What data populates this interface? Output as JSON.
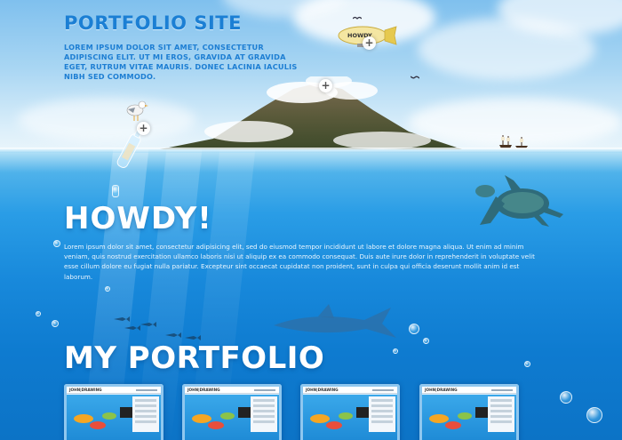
{
  "header": {
    "title": "PORTFOLIO SITE",
    "intro": "LOREM IPSUM DOLOR SIT AMET, CONSECTETUR ADIPISCING ELIT. UT MI EROS, GRAVIDA AT GRAVIDA EGET, RUTRUM VITAE MAURIS. DONEC LACINIA IACULIS NIBH SED COMMODO."
  },
  "blimp": {
    "label": "HOWDY"
  },
  "about": {
    "heading": "HOWDY!",
    "text": "Lorem ipsum dolor sit amet, consectetur adipisicing elit, sed do eiusmod tempor incididunt ut labore et dolore magna aliqua. Ut enim ad minim veniam, quis nostrud exercitation ullamco laboris nisi ut aliquip ex ea commodo consequat. Duis aute irure dolor in reprehenderit in voluptate velit esse cillum dolore eu fugiat nulla pariatur. Excepteur sint occaecat cupidatat non proident, sunt in culpa qui officia deserunt mollit anim id est laborum."
  },
  "portfolio": {
    "heading": "MY PORTFOLIO",
    "items": [
      {
        "logo": "JOHN|DRAWING"
      },
      {
        "logo": "JOHN|DRAWING"
      },
      {
        "logo": "JOHN|DRAWING"
      },
      {
        "logo": "JOHN|DRAWING"
      }
    ]
  },
  "expand_button": {
    "symbol": "+"
  },
  "colors": {
    "title_blue": "#1b7fd4",
    "sea_blue": "#1889db",
    "sky_blue": "#a9d6f3"
  }
}
